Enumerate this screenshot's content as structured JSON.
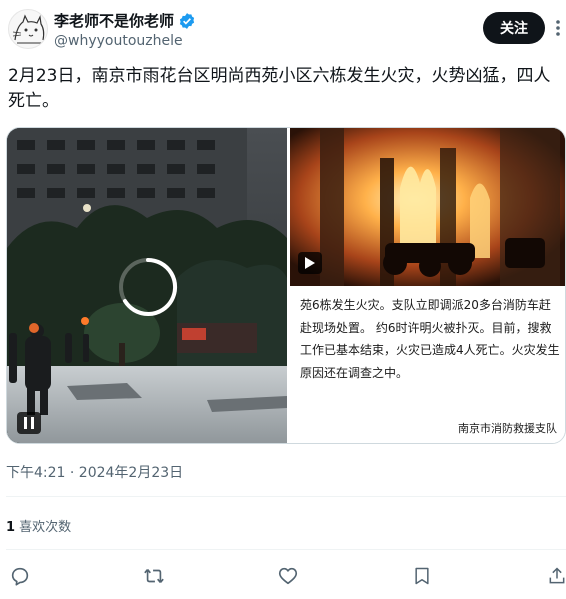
{
  "author": {
    "display_name": "李老师不是你老师",
    "handle": "@whyyoutouzhele",
    "avatar_icon": "cat-sketch-avatar",
    "verified_color": "#1d9bf0"
  },
  "follow_label": "关注",
  "more_icon": "more-dots-icon",
  "tweet_text": "2月23日，南京市雨花台区明尚西苑小区六栋发生火灾，火势凶猛，四人死亡。",
  "media": {
    "video_state_icon": "loading-spinner-icon",
    "pause_icon": "pause-icon",
    "play_icon": "play-icon",
    "news_text": "苑6栋发生火灾。支队立即调派20多台消防车赶赴现场处置。 约6时许明火被扑灭。目前，搜救工作已基本结束，火灾已造成4人死亡。火灾发生原因还在调查之中。",
    "news_source": "南京市消防救援支队"
  },
  "timestamp": "下午4:21 · 2024年2月23日",
  "likes": {
    "count": "1",
    "label": " 喜欢次数"
  },
  "actions": {
    "reply_icon": "reply-icon",
    "retweet_icon": "retweet-icon",
    "like_icon": "heart-icon",
    "bookmark_icon": "bookmark-icon",
    "share_icon": "share-icon"
  },
  "colors": {
    "text": "#0f1419",
    "secondary": "#536471",
    "accent": "#1d9bf0",
    "border": "#cfd9de"
  }
}
